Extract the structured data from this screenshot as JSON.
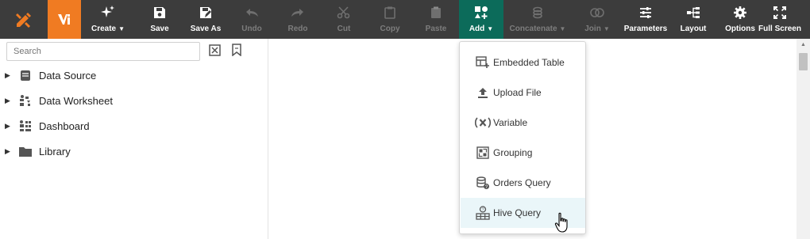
{
  "toolbar": {
    "buttons": [
      {
        "label": "Create",
        "icon": "sparkles-icon",
        "dropdown": true
      },
      {
        "label": "Save",
        "icon": "save-icon"
      },
      {
        "label": "Save As",
        "icon": "save-as-icon"
      },
      {
        "label": "Undo",
        "icon": "undo-icon",
        "disabled": true
      },
      {
        "label": "Redo",
        "icon": "redo-icon",
        "disabled": true
      },
      {
        "label": "Cut",
        "icon": "scissors-icon",
        "disabled": true
      },
      {
        "label": "Copy",
        "icon": "copy-icon",
        "disabled": true
      },
      {
        "label": "Paste",
        "icon": "paste-icon",
        "disabled": true
      },
      {
        "label": "Add",
        "icon": "add-shapes-icon",
        "dropdown": true,
        "active": true
      },
      {
        "label": "Concatenate",
        "icon": "concatenate-icon",
        "dropdown": true,
        "disabled": true
      },
      {
        "label": "Join",
        "icon": "join-icon",
        "dropdown": true,
        "disabled": true
      },
      {
        "label": "Parameters",
        "icon": "sliders-icon"
      },
      {
        "label": "Layout",
        "icon": "layout-tree-icon"
      },
      {
        "label": "Options",
        "icon": "gear-icon"
      },
      {
        "label": "Full Screen",
        "icon": "fullscreen-icon"
      }
    ]
  },
  "sidebar": {
    "search_placeholder": "Search",
    "tree": [
      {
        "label": "Data Source",
        "icon": "database-icon"
      },
      {
        "label": "Data Worksheet",
        "icon": "worksheet-icon"
      },
      {
        "label": "Dashboard",
        "icon": "dashboard-icon"
      },
      {
        "label": "Library",
        "icon": "folder-icon"
      }
    ]
  },
  "add_menu": {
    "items": [
      {
        "label": "Embedded Table",
        "icon": "embedded-table-icon"
      },
      {
        "label": "Upload File",
        "icon": "upload-icon"
      },
      {
        "label": "Variable",
        "icon": "variable-icon"
      },
      {
        "label": "Grouping",
        "icon": "grouping-icon"
      },
      {
        "label": "Orders Query",
        "icon": "database-query-icon"
      },
      {
        "label": "Hive Query",
        "icon": "hive-query-icon",
        "hovered": true
      }
    ]
  },
  "colors": {
    "toolbar_bg": "#3c3c3c",
    "brand_orange": "#f07b22",
    "active_teal": "#0c6b5a",
    "hover_bg": "#eaf6f9"
  }
}
